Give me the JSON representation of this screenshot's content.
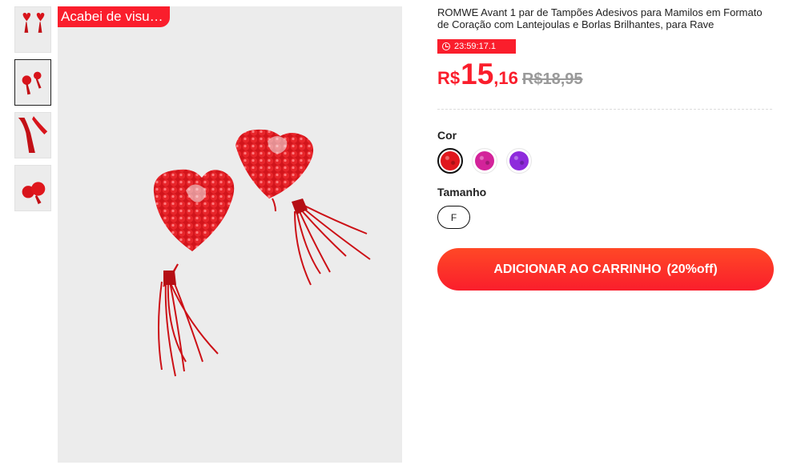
{
  "gallery": {
    "badge": "Acabei de visu…",
    "thumbnails": [
      {
        "alt": "thumbnail-1"
      },
      {
        "alt": "thumbnail-2"
      },
      {
        "alt": "thumbnail-3"
      },
      {
        "alt": "thumbnail-4"
      }
    ]
  },
  "product": {
    "title": "ROMWE Avant 1 par de Tampões Adesivos para Mamilos em Formato de Coração com Lantejoulas e Borlas Brilhantes, para Rave",
    "timer": "23:59:17.1",
    "price": {
      "currency": "R$",
      "integer": "15",
      "decimal": ",16",
      "original": "R$18,95"
    }
  },
  "color_section": {
    "label": "Cor",
    "options": [
      {
        "name": "red",
        "color": "#e0171d"
      },
      {
        "name": "pink",
        "color": "#d3239a"
      },
      {
        "name": "purple",
        "color": "#8e2bdc"
      }
    ]
  },
  "size_section": {
    "label": "Tamanho",
    "options": [
      "F"
    ]
  },
  "cart": {
    "label": "ADICIONAR AO CARRINHO",
    "discount": "(20%off)"
  },
  "colors": {
    "accent": "#fa1e2c",
    "strike": "#9a9a9a"
  }
}
